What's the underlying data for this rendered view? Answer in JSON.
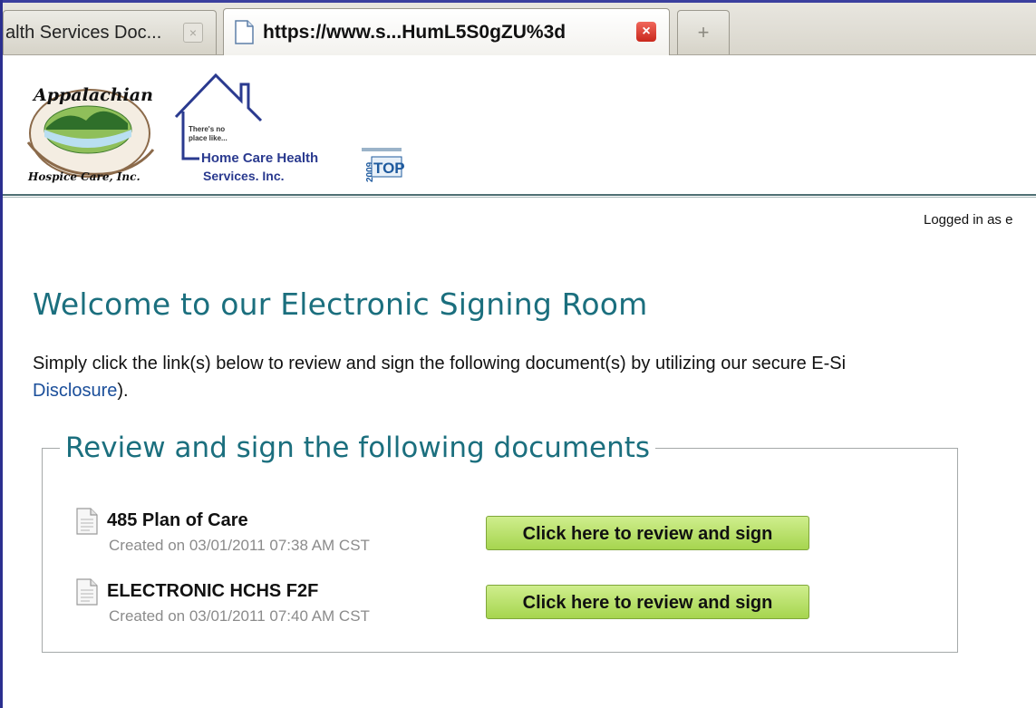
{
  "browser": {
    "tabs": [
      {
        "title": "alth Services Doc...",
        "close_symbol": "×",
        "active": false
      },
      {
        "title": "https://www.s...HumL5S0gZU%3d",
        "close_symbol": "×",
        "active": true
      }
    ],
    "new_tab_symbol": "+"
  },
  "logos": {
    "appalachian": {
      "top_text": "Appalachian",
      "bottom_text": "Hospice Care, Inc."
    },
    "home_care": {
      "tagline_1": "There's no",
      "tagline_2": "place like...",
      "name_1": "Home Care Health",
      "name_2": "Services, Inc."
    },
    "badge": {
      "year": "2009",
      "label": "TOP"
    }
  },
  "session": {
    "logged_in_text": "Logged in as e"
  },
  "main": {
    "title": "Welcome to our Electronic Signing Room",
    "intro_text": "Simply click the link(s) below to review and sign the following document(s) by utilizing our secure E-Si",
    "disclosure_link": "Disclosure",
    "intro_suffix": ")."
  },
  "documents_section": {
    "legend": "Review and sign the following documents",
    "documents": [
      {
        "title": "485 Plan of Care",
        "created": "Created on 03/01/2011 07:38 AM CST",
        "button_label": "Click here to review and sign"
      },
      {
        "title": "ELECTRONIC HCHS F2F",
        "created": "Created on 03/01/2011 07:40 AM CST",
        "button_label": "Click here to review and sign"
      }
    ]
  },
  "colors": {
    "heading": "#1b6f7e",
    "link": "#1a4e9a",
    "button_top": "#cfee8d",
    "button_bottom": "#a6d54f",
    "tab_close_red": "#c9281c"
  }
}
